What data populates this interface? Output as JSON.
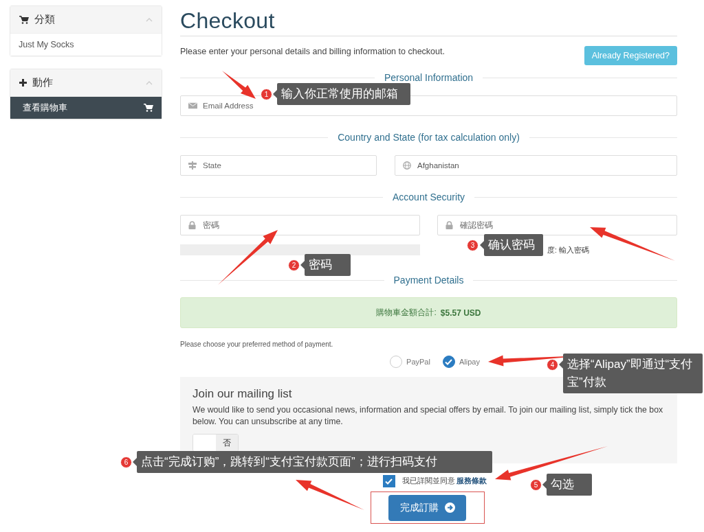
{
  "sidebar": {
    "panels": [
      {
        "title": "分類",
        "expanded": true,
        "items": [
          {
            "label": "Just My Socks",
            "selected": false
          }
        ]
      },
      {
        "title": "動作",
        "expanded": true,
        "items": [
          {
            "label": "查看購物車",
            "selected": true
          }
        ]
      }
    ]
  },
  "page": {
    "title": "Checkout",
    "intro": "Please enter your personal details and billing information to checkout.",
    "login_button": "Already Registered?"
  },
  "sections": [
    {
      "heading": "Personal Information",
      "fields": [
        {
          "kind": "text",
          "placeholder": "Email Address"
        }
      ]
    },
    {
      "heading": "Country and State (for tax calculation only)",
      "fields": [
        {
          "kind": "text",
          "placeholder": "State"
        },
        {
          "kind": "select",
          "value": "Afghanistan"
        }
      ]
    },
    {
      "heading": "Account Security",
      "fields": [
        {
          "kind": "password",
          "placeholder": "密碼"
        },
        {
          "kind": "password",
          "placeholder": "確認密碼"
        }
      ],
      "strength_text": "度: 輸入密碼"
    },
    {
      "heading": "Payment Details"
    }
  ],
  "payment": {
    "total_label": "購物車金額合計:",
    "total_value": "$5.57 USD",
    "instruction": "Please choose your preferred method of payment.",
    "methods": [
      {
        "label": "PayPal",
        "selected": false
      },
      {
        "label": "Alipay",
        "selected": true
      }
    ]
  },
  "mailing_list": {
    "title": "Join our mailing list",
    "text": "We would like to send you occasional news, information and special offers by email. To join our mailing list, simply tick the box below. You can unsubscribe at any time.",
    "toggle": {
      "label": "否",
      "on": false
    }
  },
  "terms": {
    "checked": true,
    "text": "我已詳閱並同意",
    "link": "服務條款"
  },
  "submit_button": "完成訂購",
  "annotations": [
    {
      "number": "1",
      "text": "输入你正常使用的邮箱"
    },
    {
      "number": "2",
      "text": "密码"
    },
    {
      "number": "3",
      "text": "确认密码"
    },
    {
      "number": "4",
      "text": "选择“Alipay”即通过“支付宝”付款"
    },
    {
      "number": "5",
      "text": "勾选"
    },
    {
      "number": "6",
      "text": "点击“完成订购”，跳转到“支付宝付款页面”；进行扫码支付"
    }
  ]
}
